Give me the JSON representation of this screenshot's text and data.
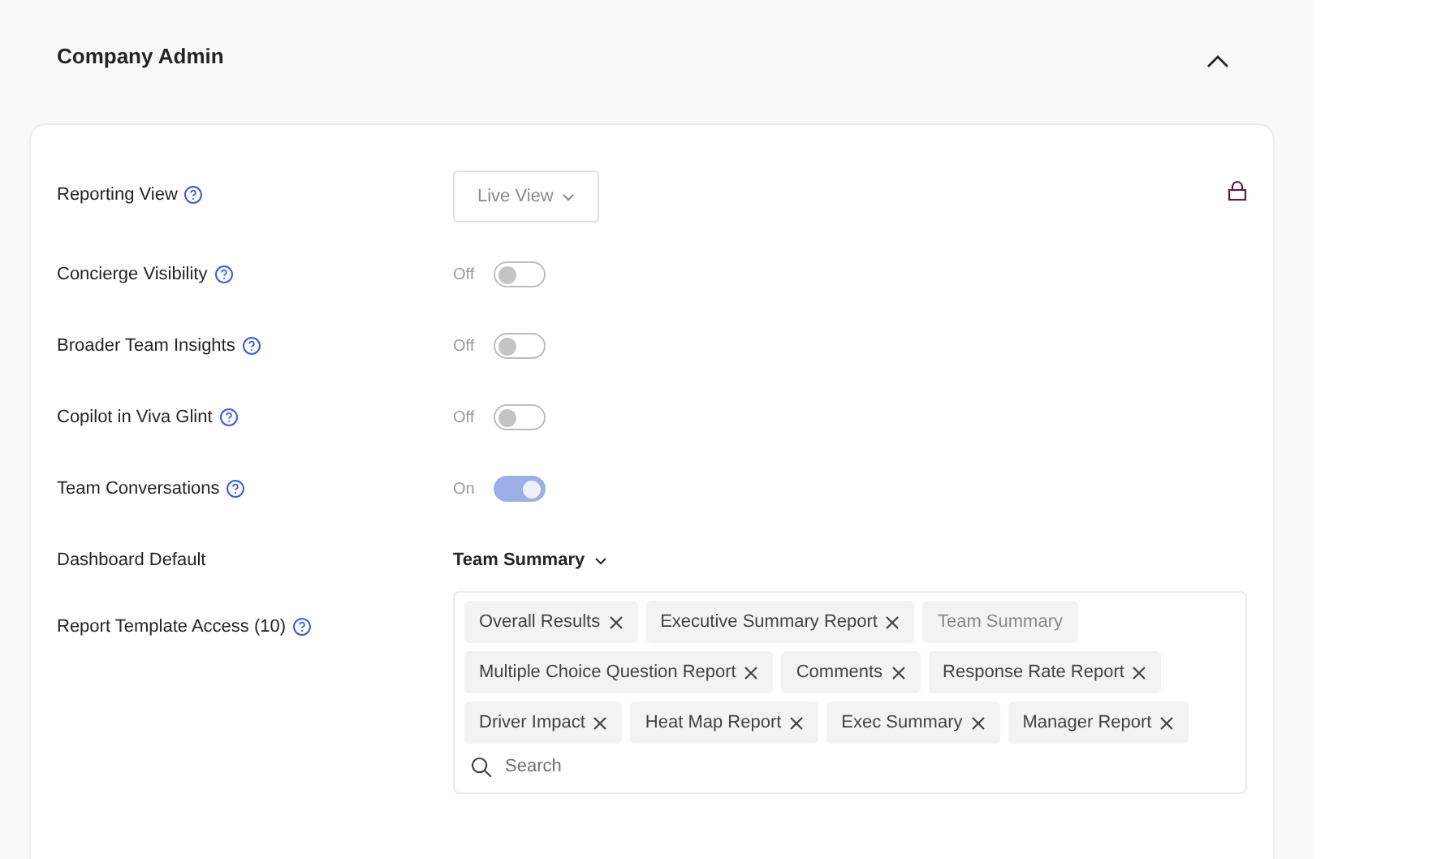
{
  "section": {
    "title": "Company Admin",
    "expanded": true
  },
  "settings": [
    {
      "kind": "dropdown",
      "label": "Reporting View",
      "help": true,
      "value": "Live View",
      "locked": true
    },
    {
      "kind": "toggle",
      "label": "Concierge Visibility",
      "help": true,
      "state_text": "Off",
      "on": false
    },
    {
      "kind": "toggle",
      "label": "Broader Team Insights",
      "help": true,
      "state_text": "Off",
      "on": false
    },
    {
      "kind": "toggle",
      "label": "Copilot in Viva Glint",
      "help": true,
      "state_text": "Off",
      "on": false
    },
    {
      "kind": "toggle",
      "label": "Team Conversations",
      "help": true,
      "state_text": "On",
      "on": true
    },
    {
      "kind": "select",
      "label": "Dashboard Default",
      "help": false,
      "value": "Team Summary"
    },
    {
      "kind": "tags",
      "label": "Report Template Access (10)",
      "help": true,
      "search_placeholder": "Search",
      "tags": [
        {
          "label": "Overall Results",
          "removable": true
        },
        {
          "label": "Executive Summary Report",
          "removable": true
        },
        {
          "label": "Team Summary",
          "removable": false
        },
        {
          "label": "Multiple Choice Question Report",
          "removable": true
        },
        {
          "label": "Comments",
          "removable": true
        },
        {
          "label": "Response Rate Report",
          "removable": true
        },
        {
          "label": "Driver Impact",
          "removable": true
        },
        {
          "label": "Heat Map Report",
          "removable": true
        },
        {
          "label": "Exec Summary",
          "removable": true
        },
        {
          "label": "Manager Report",
          "removable": true
        }
      ]
    }
  ]
}
